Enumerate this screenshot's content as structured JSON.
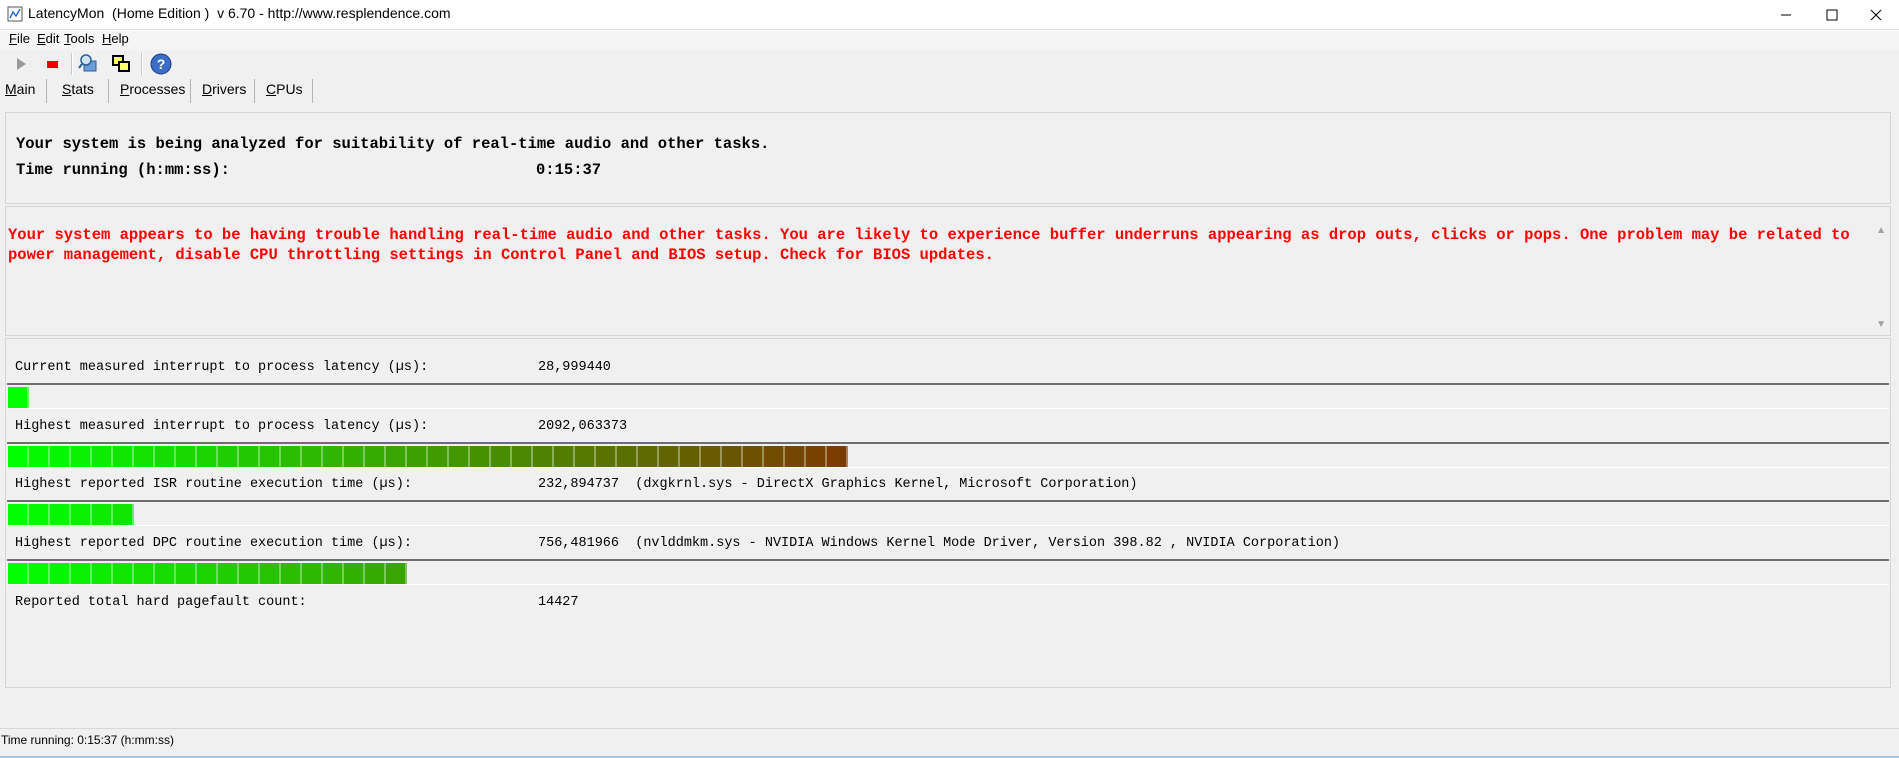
{
  "window": {
    "title": "LatencyMon  (Home Edition )  v 6.70 - http://www.resplendence.com"
  },
  "menu": [
    {
      "underline": "F",
      "rest": "ile"
    },
    {
      "underline": "E",
      "rest": "dit"
    },
    {
      "underline": "T",
      "rest": "ools"
    },
    {
      "underline": "H",
      "rest": "elp"
    }
  ],
  "toolbar": {
    "icons": [
      "play-icon",
      "stop-icon",
      "driver-search-icon",
      "windows-icon",
      "help-icon"
    ]
  },
  "tabs": [
    {
      "underline": "M",
      "rest": "ain"
    },
    {
      "underline": "S",
      "rest": "tats"
    },
    {
      "underline": "P",
      "rest": "rocesses"
    },
    {
      "underline": "D",
      "rest": "rivers"
    },
    {
      "underline": "C",
      "rest": "PUs"
    }
  ],
  "status_panel": {
    "analysis_text": "Your system is being analyzed for suitability of real-time audio and other tasks.",
    "time_label": "Time running (h:mm:ss):",
    "time_value": "0:15:37"
  },
  "message": {
    "text": "Your system appears to be having trouble handling real-time audio and other tasks. You are likely to experience buffer underruns appearing as drop outs, clicks or pops. One problem may be related to power management, disable CPU throttling settings in Control Panel and BIOS setup. Check for BIOS updates.",
    "color": "#ff0000"
  },
  "metrics": [
    {
      "label": "Current measured interrupt to process latency (µs):",
      "value": "28,999440",
      "detail": "",
      "bar_segments": 1
    },
    {
      "label": "Highest measured interrupt to process latency (µs):",
      "value": "2092,063373",
      "detail": "",
      "bar_segments": 40
    },
    {
      "label": "Highest reported ISR routine execution time (µs):",
      "value": "232,894737",
      "detail": "(dxgkrnl.sys - DirectX Graphics Kernel, Microsoft Corporation)",
      "bar_segments": 6
    },
    {
      "label": "Highest reported DPC routine execution time (µs):",
      "value": "756,481966",
      "detail": "(nvlddmkm.sys - NVIDIA Windows Kernel Mode Driver, Version 398.82 , NVIDIA Corporation)",
      "bar_segments": 19
    },
    {
      "label": "Reported total hard pagefault count:",
      "value": "14427",
      "detail": ""
    }
  ],
  "statusbar": {
    "text": "Time running: 0:15:37  (h:mm:ss)"
  },
  "colors": {
    "bar_start": "#00ff00",
    "bar_end": "#7a3c00"
  }
}
